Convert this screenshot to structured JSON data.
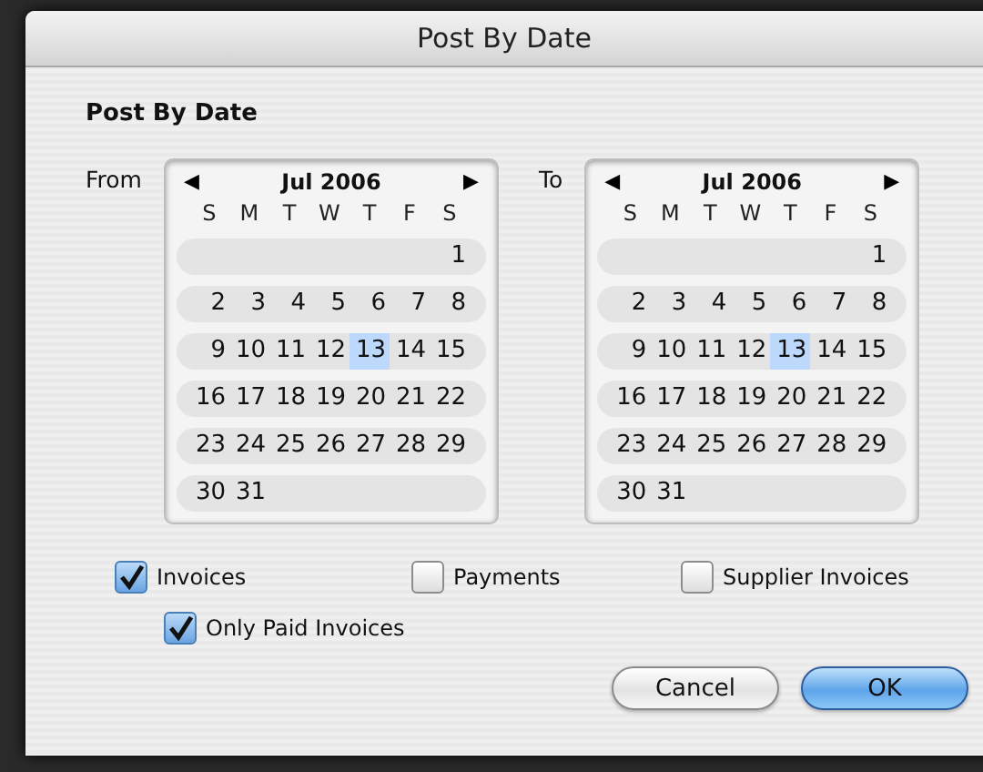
{
  "window": {
    "title": "Post By Date"
  },
  "heading": "Post By Date",
  "calendars": [
    {
      "label": "From",
      "month": "Jul 2006",
      "prev": "◀",
      "next": "▶",
      "weekdays": [
        "S",
        "M",
        "T",
        "W",
        "T",
        "F",
        "S"
      ],
      "weeks": [
        [
          {
            "day": "1",
            "selected": false
          }
        ],
        [
          {
            "day": "2",
            "selected": false
          },
          {
            "day": "3",
            "selected": false
          },
          {
            "day": "4",
            "selected": false
          },
          {
            "day": "5",
            "selected": false
          },
          {
            "day": "6",
            "selected": false
          },
          {
            "day": "7",
            "selected": false
          },
          {
            "day": "8",
            "selected": false
          }
        ],
        [
          {
            "day": "9",
            "selected": false
          },
          {
            "day": "10",
            "selected": false
          },
          {
            "day": "11",
            "selected": false
          },
          {
            "day": "12",
            "selected": false
          },
          {
            "day": "13",
            "selected": true
          },
          {
            "day": "14",
            "selected": false
          },
          {
            "day": "15",
            "selected": false
          }
        ],
        [
          {
            "day": "16",
            "selected": false
          },
          {
            "day": "17",
            "selected": false
          },
          {
            "day": "18",
            "selected": false
          },
          {
            "day": "19",
            "selected": false
          },
          {
            "day": "20",
            "selected": false
          },
          {
            "day": "21",
            "selected": false
          },
          {
            "day": "22",
            "selected": false
          }
        ],
        [
          {
            "day": "23",
            "selected": false
          },
          {
            "day": "24",
            "selected": false
          },
          {
            "day": "25",
            "selected": false
          },
          {
            "day": "26",
            "selected": false
          },
          {
            "day": "27",
            "selected": false
          },
          {
            "day": "28",
            "selected": false
          },
          {
            "day": "29",
            "selected": false
          }
        ],
        [
          {
            "day": "30",
            "selected": false
          },
          {
            "day": "31",
            "selected": false
          }
        ]
      ]
    },
    {
      "label": "To",
      "month": "Jul 2006",
      "prev": "◀",
      "next": "▶",
      "weekdays": [
        "S",
        "M",
        "T",
        "W",
        "T",
        "F",
        "S"
      ],
      "weeks": [
        [
          {
            "day": "1",
            "selected": false
          }
        ],
        [
          {
            "day": "2",
            "selected": false
          },
          {
            "day": "3",
            "selected": false
          },
          {
            "day": "4",
            "selected": false
          },
          {
            "day": "5",
            "selected": false
          },
          {
            "day": "6",
            "selected": false
          },
          {
            "day": "7",
            "selected": false
          },
          {
            "day": "8",
            "selected": false
          }
        ],
        [
          {
            "day": "9",
            "selected": false
          },
          {
            "day": "10",
            "selected": false
          },
          {
            "day": "11",
            "selected": false
          },
          {
            "day": "12",
            "selected": false
          },
          {
            "day": "13",
            "selected": true
          },
          {
            "day": "14",
            "selected": false
          },
          {
            "day": "15",
            "selected": false
          }
        ],
        [
          {
            "day": "16",
            "selected": false
          },
          {
            "day": "17",
            "selected": false
          },
          {
            "day": "18",
            "selected": false
          },
          {
            "day": "19",
            "selected": false
          },
          {
            "day": "20",
            "selected": false
          },
          {
            "day": "21",
            "selected": false
          },
          {
            "day": "22",
            "selected": false
          }
        ],
        [
          {
            "day": "23",
            "selected": false
          },
          {
            "day": "24",
            "selected": false
          },
          {
            "day": "25",
            "selected": false
          },
          {
            "day": "26",
            "selected": false
          },
          {
            "day": "27",
            "selected": false
          },
          {
            "day": "28",
            "selected": false
          },
          {
            "day": "29",
            "selected": false
          }
        ],
        [
          {
            "day": "30",
            "selected": false
          },
          {
            "day": "31",
            "selected": false
          }
        ]
      ]
    }
  ],
  "options": [
    {
      "label": "Invoices",
      "checked": true
    },
    {
      "label": "Payments",
      "checked": false
    },
    {
      "label": "Supplier Invoices",
      "checked": false
    }
  ],
  "sub_option": {
    "label": "Only Paid Invoices",
    "checked": true
  },
  "buttons": [
    {
      "label": "Cancel",
      "kind": "normal"
    },
    {
      "label": "OK",
      "kind": "default"
    }
  ]
}
